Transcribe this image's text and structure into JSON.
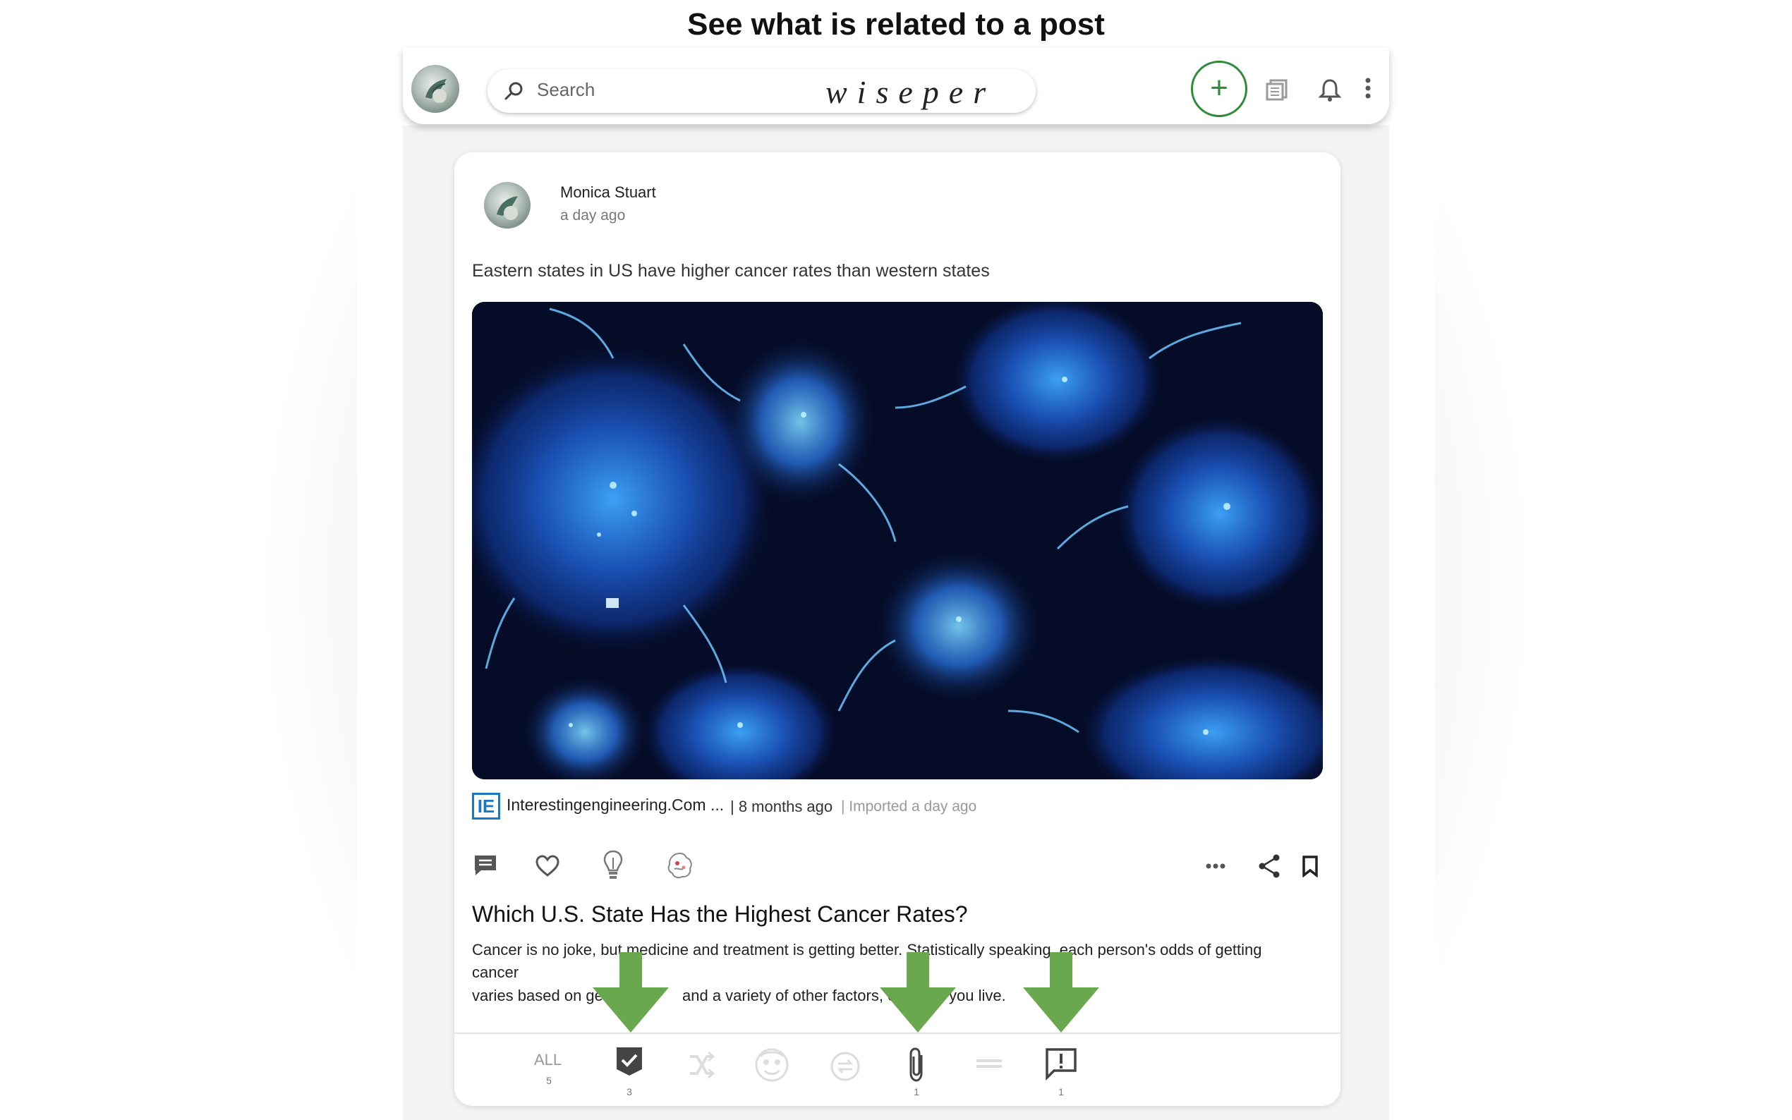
{
  "caption": "See what is related to a post",
  "header": {
    "search_placeholder": "Search",
    "logo_text": "wiseper",
    "add_button": "+",
    "icons": [
      "feed-icon",
      "bell-icon",
      "more-vert-icon"
    ]
  },
  "post": {
    "author": "Monica Stuart",
    "time": "a day ago",
    "text": "Eastern states in US have higher cancer rates than western states",
    "image_alt": "cancer-cells-microscopy",
    "source": {
      "logo": "IE",
      "name": "Interestingengineering.Com ...",
      "age": "| 8 months ago",
      "imported": "| Imported a day ago"
    },
    "actions": [
      "comment-icon",
      "heart-icon",
      "lightbulb-icon",
      "brain-icon",
      "more-horiz-icon",
      "share-icon",
      "bookmark-icon"
    ],
    "article": {
      "title": "Which U.S. State Has the Highest Cancer Rates?",
      "line1": "Cancer is no joke, but medicine and treatment is getting better. Statistically speaking, each person's odds of getting",
      "line2": "cancer",
      "line3_start": "varies based on ge",
      "line3_mid": "and a variety of other factors, eve",
      "line3_end": "you live."
    }
  },
  "tabs": {
    "all_label": "ALL",
    "all_count": "5",
    "supporting_count": "3",
    "attachment_count": "1",
    "report_count": "1"
  },
  "colors": {
    "accent_green": "#2e8b3a",
    "arrow_green": "#6aa84f",
    "source_blue": "#1b78c2"
  }
}
